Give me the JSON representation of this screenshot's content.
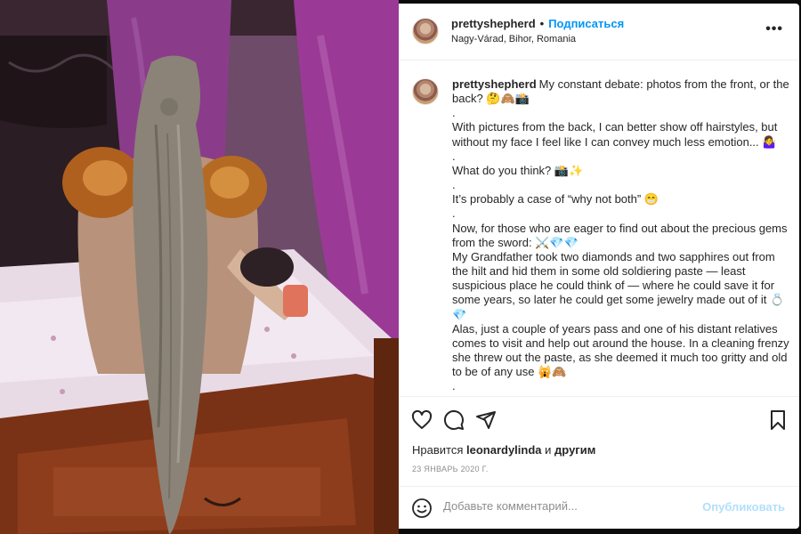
{
  "post": {
    "username": "prettyshepherd",
    "separator": "•",
    "follow_label": "Подписаться",
    "location": "Nagy-Várad, Bihor, Romania",
    "more_label": "•••"
  },
  "caption": {
    "author": "prettyshepherd",
    "lines": [
      "My constant debate: photos from the front, or the back? 🤔🙈📸",
      ".",
      "With pictures from the back, I can better show off hairstyles, but without my face I feel like I can convey much less emotion... 🤷‍♀️",
      ".",
      "What do you think? 📸✨",
      ".",
      "It’s probably a case of “why not both” 😁",
      ".",
      "Now, for those who are eager to find out about the precious gems from the sword: ⚔️💎💎",
      "My Grandfather took two diamonds and two sapphires out from the hilt and hid them in some old soldiering paste — least suspicious place he could think of — where he could save it for some years, so later he could get some jewelry made out of it 💍💎",
      "Alas, just a couple of years pass and one of his distant relatives comes to visit and help out around the house. In a cleaning frenzy she threw out the paste, as she deemed it much too gritty and old to be of any use 🙀🙈",
      "."
    ]
  },
  "engagement": {
    "likes_prefix": "Нравится",
    "likes_user": "leonardylinda",
    "likes_and": "и",
    "likes_others": "другим",
    "date": "23 ЯНВАРЬ 2020 Г."
  },
  "comment": {
    "placeholder": "Добавьте комментарий...",
    "post_label": "Опубликовать"
  },
  "icons": {
    "like": "heart-icon",
    "comment": "comment-icon",
    "share": "share-icon",
    "save": "bookmark-icon",
    "emoji": "emoji-icon"
  },
  "colors": {
    "accent": "#0095f6",
    "post_disabled": "#b2dffc",
    "text": "#262626",
    "muted": "#8e8e8e"
  }
}
